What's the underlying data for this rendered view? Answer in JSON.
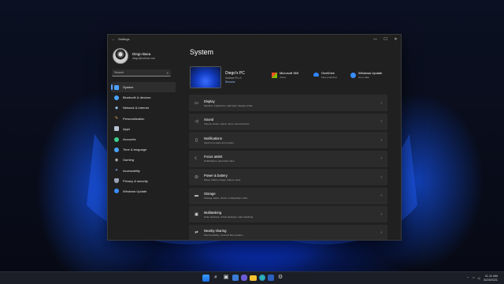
{
  "window": {
    "app_title": "Settings",
    "controls": [
      "—",
      "☐",
      "✕"
    ]
  },
  "profile": {
    "name": "Diego Baca",
    "email": "diego@outlook.com"
  },
  "search": {
    "placeholder": "Search"
  },
  "nav": [
    {
      "label": "System",
      "icon": "system-icon",
      "color": "#4aa3ff"
    },
    {
      "label": "Bluetooth & devices",
      "icon": "bluetooth-icon",
      "color": "#4aa3ff"
    },
    {
      "label": "Network & internet",
      "icon": "network-icon",
      "color": "#9ecbff"
    },
    {
      "label": "Personalization",
      "icon": "brush-icon",
      "color": "#ffb86b"
    },
    {
      "label": "Apps",
      "icon": "apps-icon",
      "color": "#b9c3d6"
    },
    {
      "label": "Accounts",
      "icon": "accounts-icon",
      "color": "#3ecf8e"
    },
    {
      "label": "Time & language",
      "icon": "globe-clock-icon",
      "color": "#4aa3ff"
    },
    {
      "label": "Gaming",
      "icon": "gaming-icon",
      "color": "#c9c9c9"
    },
    {
      "label": "Accessibility",
      "icon": "accessibility-icon",
      "color": "#7fb2ff"
    },
    {
      "label": "Privacy & security",
      "icon": "shield-icon",
      "color": "#9aa4b5"
    },
    {
      "label": "Windows Update",
      "icon": "update-icon",
      "color": "#3a8dff"
    }
  ],
  "page": {
    "title": "System",
    "device": {
      "name": "Diego's PC",
      "model": "Surface Pro X",
      "rename": "Rename"
    },
    "quick": [
      {
        "title": "Microsoft 365",
        "subtitle": "Active",
        "icon": "microsoft365-icon"
      },
      {
        "title": "OneDrive",
        "subtitle": "Files protected",
        "icon": "onedrive-icon"
      },
      {
        "title": "Windows Update",
        "subtitle": "Up to date",
        "icon": "windows-update-icon"
      }
    ],
    "settings": [
      {
        "title": "Display",
        "subtitle": "Monitors, brightness, night light, display profile",
        "icon": "display-icon"
      },
      {
        "title": "Sound",
        "subtitle": "Volume levels, output, input, sound devices",
        "icon": "sound-icon"
      },
      {
        "title": "Notifications",
        "subtitle": "Alerts from apps and system",
        "icon": "notifications-icon"
      },
      {
        "title": "Focus assist",
        "subtitle": "Notifications, automatic rules",
        "icon": "focus-assist-icon"
      },
      {
        "title": "Power & battery",
        "subtitle": "Sleep, battery usage, battery saver",
        "icon": "power-icon"
      },
      {
        "title": "Storage",
        "subtitle": "Storage space, drives, configuration rules",
        "icon": "storage-icon"
      },
      {
        "title": "Multitasking",
        "subtitle": "Snap windows, virtual desktops, task switching",
        "icon": "multitasking-icon"
      },
      {
        "title": "Nearby sharing",
        "subtitle": "Discoverability, received files location",
        "icon": "nearby-sharing-icon"
      }
    ]
  },
  "taskbar": {
    "icons": [
      "windows-start-icon",
      "search-icon",
      "task-view-icon",
      "widgets-icon",
      "chat-icon",
      "file-explorer-icon",
      "edge-icon",
      "store-icon",
      "settings-icon"
    ],
    "time": "11:11 AM",
    "date": "5/24/2021"
  }
}
